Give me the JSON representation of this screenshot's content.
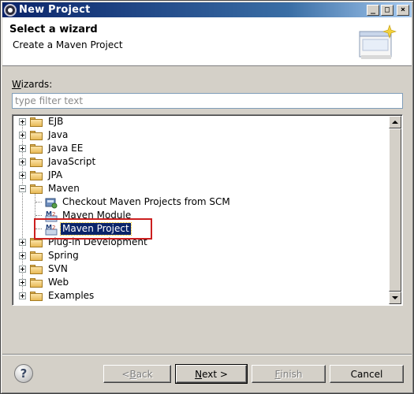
{
  "window": {
    "title": "New Project",
    "controls": {
      "minimize": "_",
      "maximize": "□",
      "close": "×"
    }
  },
  "header": {
    "title": "Select a wizard",
    "description": "Create a Maven Project"
  },
  "wizards": {
    "label_underlined": "W",
    "label_rest": "izards:",
    "filter_placeholder": "type filter text",
    "filter_value": ""
  },
  "tree": {
    "items": [
      {
        "label": "EJB",
        "level": 0,
        "type": "folder",
        "expanded": false
      },
      {
        "label": "Java",
        "level": 0,
        "type": "folder",
        "expanded": false
      },
      {
        "label": "Java EE",
        "level": 0,
        "type": "folder",
        "expanded": false
      },
      {
        "label": "JavaScript",
        "level": 0,
        "type": "folder",
        "expanded": false
      },
      {
        "label": "JPA",
        "level": 0,
        "type": "folder",
        "expanded": false
      },
      {
        "label": "Maven",
        "level": 0,
        "type": "folder",
        "expanded": true
      },
      {
        "label": "Checkout Maven Projects from SCM",
        "level": 1,
        "type": "scm-icon"
      },
      {
        "label": "Maven Module",
        "level": 1,
        "type": "maven-icon"
      },
      {
        "label": "Maven Project",
        "level": 1,
        "type": "maven-icon",
        "selected": true
      },
      {
        "label": "Plug-in Development",
        "level": 0,
        "type": "folder",
        "expanded": false
      },
      {
        "label": "Spring",
        "level": 0,
        "type": "folder",
        "expanded": false
      },
      {
        "label": "SVN",
        "level": 0,
        "type": "folder",
        "expanded": false
      },
      {
        "label": "Web",
        "level": 0,
        "type": "folder",
        "expanded": false
      },
      {
        "label": "Examples",
        "level": 0,
        "type": "folder",
        "expanded": false
      }
    ]
  },
  "buttons": {
    "help": "?",
    "back_pre": "< ",
    "back_u": "B",
    "back_post": "ack",
    "next_u": "N",
    "next_post": "ext >",
    "finish_u": "F",
    "finish_post": "inish",
    "cancel": "Cancel"
  },
  "colors": {
    "selection": "#0a246a",
    "highlight_box": "#cc1f1f",
    "dialog_bg": "#d4d0c8"
  }
}
